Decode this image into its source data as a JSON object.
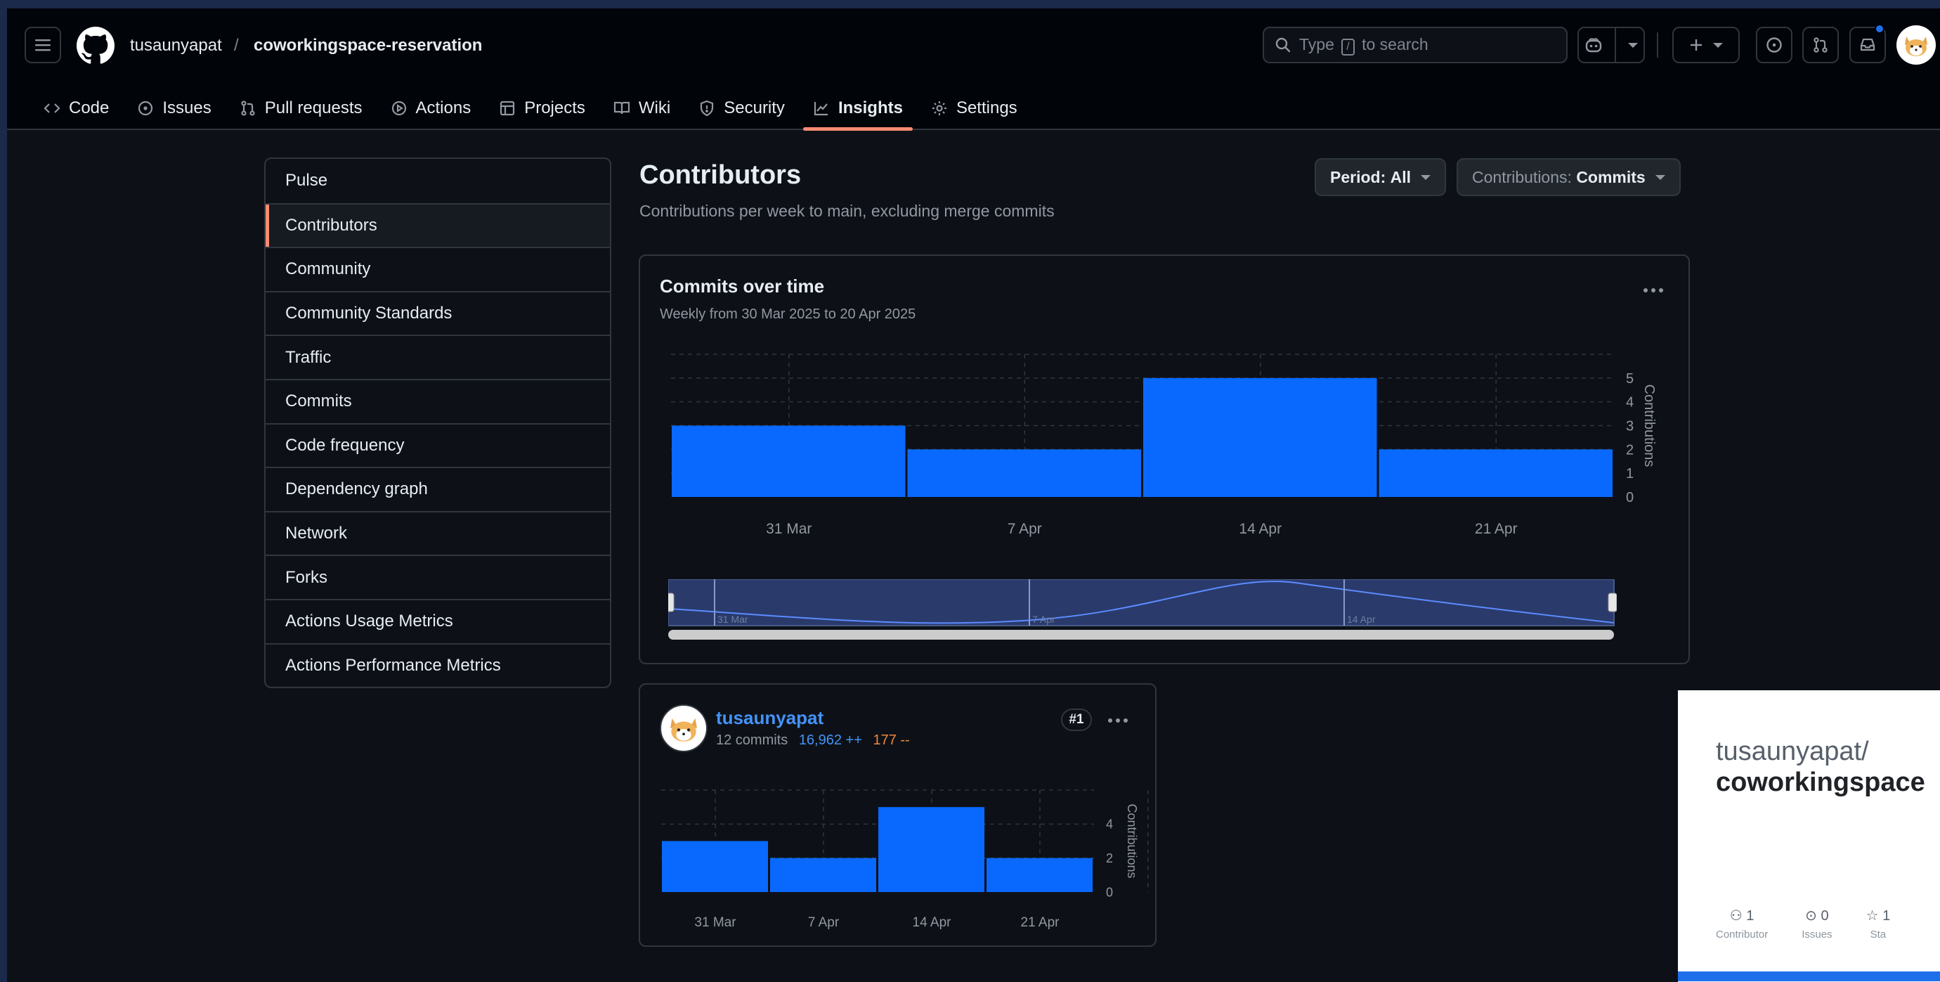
{
  "header": {
    "owner": "tusaunyapat",
    "separator": "/",
    "repo": "coworkingspace-reservation",
    "search": {
      "prefix": "Type",
      "key": "/",
      "suffix": "to search"
    }
  },
  "tabs": [
    {
      "label": "Code",
      "icon": "code-icon"
    },
    {
      "label": "Issues",
      "icon": "issue-icon"
    },
    {
      "label": "Pull requests",
      "icon": "pull-request-icon"
    },
    {
      "label": "Actions",
      "icon": "play-icon"
    },
    {
      "label": "Projects",
      "icon": "table-icon"
    },
    {
      "label": "Wiki",
      "icon": "book-icon"
    },
    {
      "label": "Security",
      "icon": "shield-icon"
    },
    {
      "label": "Insights",
      "icon": "graph-icon",
      "active": true
    },
    {
      "label": "Settings",
      "icon": "gear-icon"
    }
  ],
  "sidebar": {
    "items": [
      {
        "label": "Pulse"
      },
      {
        "label": "Contributors",
        "active": true
      },
      {
        "label": "Community"
      },
      {
        "label": "Community Standards"
      },
      {
        "label": "Traffic"
      },
      {
        "label": "Commits"
      },
      {
        "label": "Code frequency"
      },
      {
        "label": "Dependency graph"
      },
      {
        "label": "Network"
      },
      {
        "label": "Forks"
      },
      {
        "label": "Actions Usage Metrics"
      },
      {
        "label": "Actions Performance Metrics"
      }
    ]
  },
  "page": {
    "title": "Contributors",
    "subtitle": "Contributions per week to main, excluding merge commits",
    "period": {
      "label": "Period:",
      "value": "All"
    },
    "contributions": {
      "label": "Contributions:",
      "value": "Commits"
    }
  },
  "colors": {
    "accent": "#fd8c73",
    "bar": "#0969ff",
    "link": "#4493f8",
    "additions": "#4493f8",
    "deletions": "#f0883e"
  },
  "commits_card": {
    "title": "Commits over time",
    "subtitle": "Weekly from 30 Mar 2025 to 20 Apr 2025",
    "navigator_labels": [
      "31 Mar",
      "7 Apr",
      "14 Apr"
    ]
  },
  "contributor": {
    "name": "tusaunyapat",
    "commits": "12 commits",
    "additions": "16,962 ++",
    "deletions": "177 --",
    "rank": "#1"
  },
  "chart_data": [
    {
      "type": "bar",
      "title": "Commits over time",
      "categories": [
        "31 Mar",
        "7 Apr",
        "14 Apr",
        "21 Apr"
      ],
      "values": [
        3,
        2,
        5,
        2
      ],
      "ylabel": "Contributions",
      "yticks": [
        0,
        1,
        2,
        3,
        4,
        5
      ],
      "ylim": [
        0,
        6
      ],
      "grid": true
    },
    {
      "type": "bar",
      "title": "",
      "categories": [
        "31 Mar",
        "7 Apr",
        "14 Apr",
        "21 Apr"
      ],
      "values": [
        3,
        2,
        5,
        2
      ],
      "ylabel": "Contributions",
      "yticks": [
        0,
        2,
        4
      ],
      "ylim": [
        0,
        6
      ],
      "grid": true
    }
  ],
  "popover": {
    "owner": "tusaunyapat/",
    "repo": "coworkingspace",
    "stats": [
      {
        "value": "1",
        "label": "Contributor",
        "icon": "people-icon"
      },
      {
        "value": "0",
        "label": "Issues",
        "icon": "issue-icon"
      },
      {
        "value": "1",
        "label": "Sta",
        "icon": "star-icon"
      }
    ]
  }
}
